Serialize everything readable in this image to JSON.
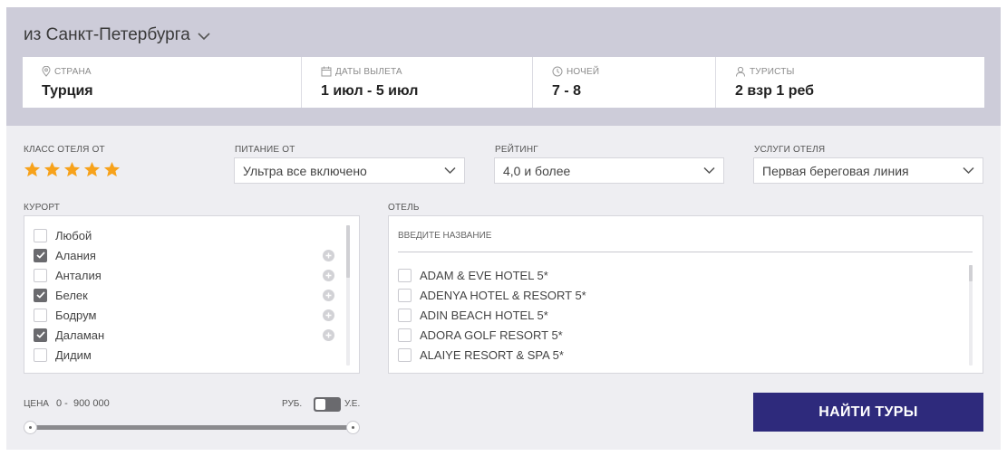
{
  "header": {
    "origin_label": "из Санкт-Петербурга"
  },
  "summary": {
    "country_label": "СТРАНА",
    "country_value": "Турция",
    "dates_label": "ДАТЫ ВЫЛЕТА",
    "dates_value": "1 июл - 5 июл",
    "nights_label": "НОЧЕЙ",
    "nights_value": "7 - 8",
    "tourists_label": "ТУРИСТЫ",
    "tourists_value": "2 взр 1 реб"
  },
  "filters": {
    "hotel_class_label": "КЛАСС ОТЕЛЯ ОТ",
    "hotel_class_stars": 5,
    "star_color": "#f7a21b",
    "meal_label": "ПИТАНИЕ ОТ",
    "meal_value": "Ультра все включено",
    "rating_label": "РЕЙТИНГ",
    "rating_value": "4,0 и более",
    "services_label": "УСЛУГИ ОТЕЛЯ",
    "services_value": "Первая береговая линия"
  },
  "resort": {
    "label": "КУРОРТ",
    "items": [
      {
        "label": "Любой",
        "checked": false,
        "has_plus": false
      },
      {
        "label": "Алания",
        "checked": true,
        "has_plus": true
      },
      {
        "label": "Анталия",
        "checked": false,
        "has_plus": true
      },
      {
        "label": "Белек",
        "checked": true,
        "has_plus": true
      },
      {
        "label": "Бодрум",
        "checked": false,
        "has_plus": true
      },
      {
        "label": "Даламан",
        "checked": true,
        "has_plus": true
      },
      {
        "label": "Дидим",
        "checked": false,
        "has_plus": false
      }
    ]
  },
  "hotel": {
    "label": "ОТЕЛЬ",
    "search_placeholder": "ВВЕДИТЕ НАЗВАНИЕ",
    "items": [
      {
        "label": "ADAM & EVE HOTEL 5*"
      },
      {
        "label": "ADENYA HOTEL & RESORT 5*"
      },
      {
        "label": "ADIN BEACH HOTEL 5*"
      },
      {
        "label": "ADORA GOLF RESORT 5*"
      },
      {
        "label": "ALAIYE RESORT & SPA 5*"
      }
    ]
  },
  "price": {
    "label": "ЦЕНА",
    "range_text": "0 -  900 000",
    "currency_left": "РУБ.",
    "currency_right": "У.Е."
  },
  "search_button": "НАЙТИ ТУРЫ",
  "colors": {
    "top_bg": "#cdccd9",
    "panel_bg": "#eeeef2",
    "button_bg": "#2e2a7c"
  }
}
